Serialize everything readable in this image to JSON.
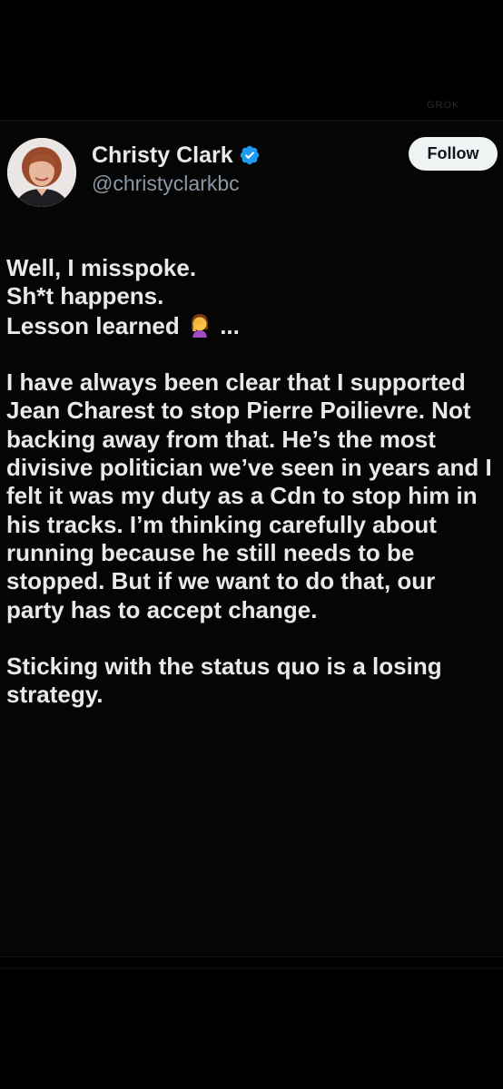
{
  "header": {
    "faint_label": "GROK"
  },
  "author": {
    "display_name": "Christy Clark",
    "handle": "@christyclarkbc",
    "verified": true,
    "verified_color": "#1d9bf0",
    "avatar_icon": "profile-photo"
  },
  "actions": {
    "follow_label": "Follow"
  },
  "tweet": {
    "line1": "Well, I misspoke.",
    "line2": "Sh*t happens.",
    "line3_text": "Lesson learned",
    "line3_emoji": "woman-facepalming",
    "line3_tail": " ...",
    "para2": "I have always been clear that I supported Jean Charest to stop Pierre Poilievre.  Not backing away from that. He’s the most divisive politician we’ve seen in years and I felt it was my duty as a Cdn to stop him in his tracks. I’m thinking carefully about running because he still needs to be stopped. But if we want to do that, our party has to accept change.",
    "para3": "Sticking with the status quo is a losing strategy."
  }
}
